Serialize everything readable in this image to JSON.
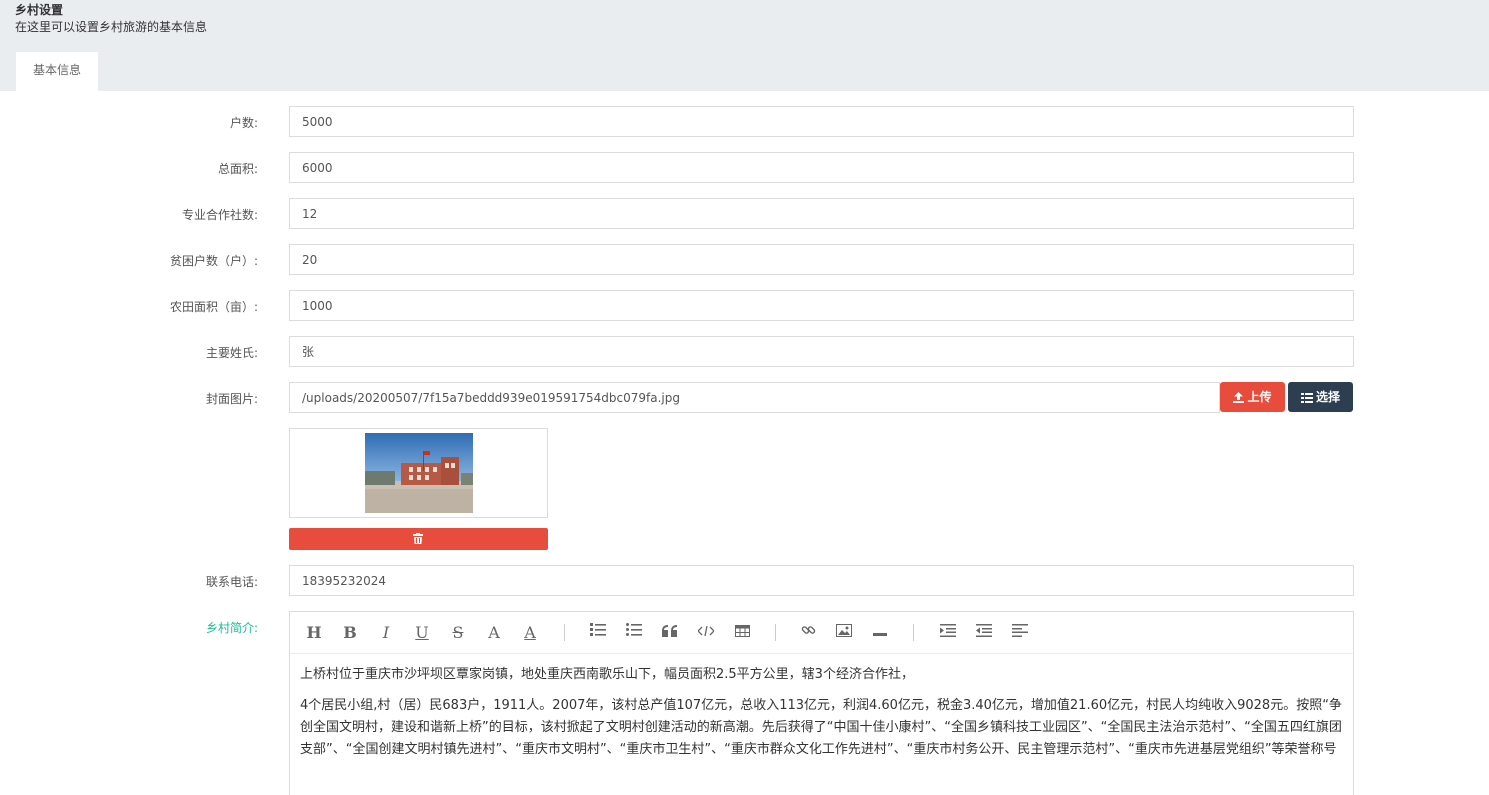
{
  "header": {
    "title": "乡村设置",
    "subtitle": "在这里可以设置乡村旅游的基本信息",
    "tabs": [
      {
        "label": "基本信息"
      }
    ]
  },
  "form": {
    "households": {
      "label": "户数:",
      "value": "5000"
    },
    "total_area": {
      "label": "总面积:",
      "value": "6000"
    },
    "cooperatives": {
      "label": "专业合作社数:",
      "value": "12"
    },
    "poor_households": {
      "label": "贫困户数（户）:",
      "value": "20"
    },
    "farmland_area": {
      "label": "农田面积（亩）:",
      "value": "1000"
    },
    "main_surname": {
      "label": "主要姓氏:",
      "value": "张"
    },
    "cover_image": {
      "label": "封面图片:",
      "value": "/uploads/20200507/7f15a7beddd939e019591754dbc079fa.jpg",
      "upload_label": "上传",
      "choose_label": "选择"
    },
    "phone": {
      "label": "联系电话:",
      "value": "18395232024"
    },
    "intro": {
      "label": "乡村简介:",
      "paragraphs": [
        "上桥村位于重庆市沙坪坝区覃家岗镇，地处重庆西南歌乐山下，幅员面积2.5平方公里，辖3个经济合作社，",
        "4个居民小组,村（居）民683户，1911人。2007年，该村总产值107亿元，总收入113亿元，利润4.60亿元，税金3.40亿元，增加值21.60亿元，村民人均纯收入9028元。按照“争创全国文明村，建设和谐新上桥”的目标，该村掀起了文明村创建活动的新高潮。先后获得了“中国十佳小康村”、“全国乡镇科技工业园区”、“全国民主法治示范村”、“全国五四红旗团支部”、“全国创建文明村镇先进村”、“重庆市文明村”、“重庆市卫生村”、“重庆市群众文化工作先进村”、“重庆市村务公开、民主管理示范村”、“重庆市先进基层党组织”等荣誉称号"
      ]
    }
  },
  "editor_toolbar": {
    "heading": "H",
    "bold": "B",
    "italic": "I",
    "underline": "U",
    "strike": "S",
    "font_color": "A",
    "bg_color": "A"
  },
  "colors": {
    "danger": "#e74c3c",
    "primary_dark": "#2c3e50",
    "success": "#18bc9c",
    "header_bg": "#e9edf0"
  }
}
